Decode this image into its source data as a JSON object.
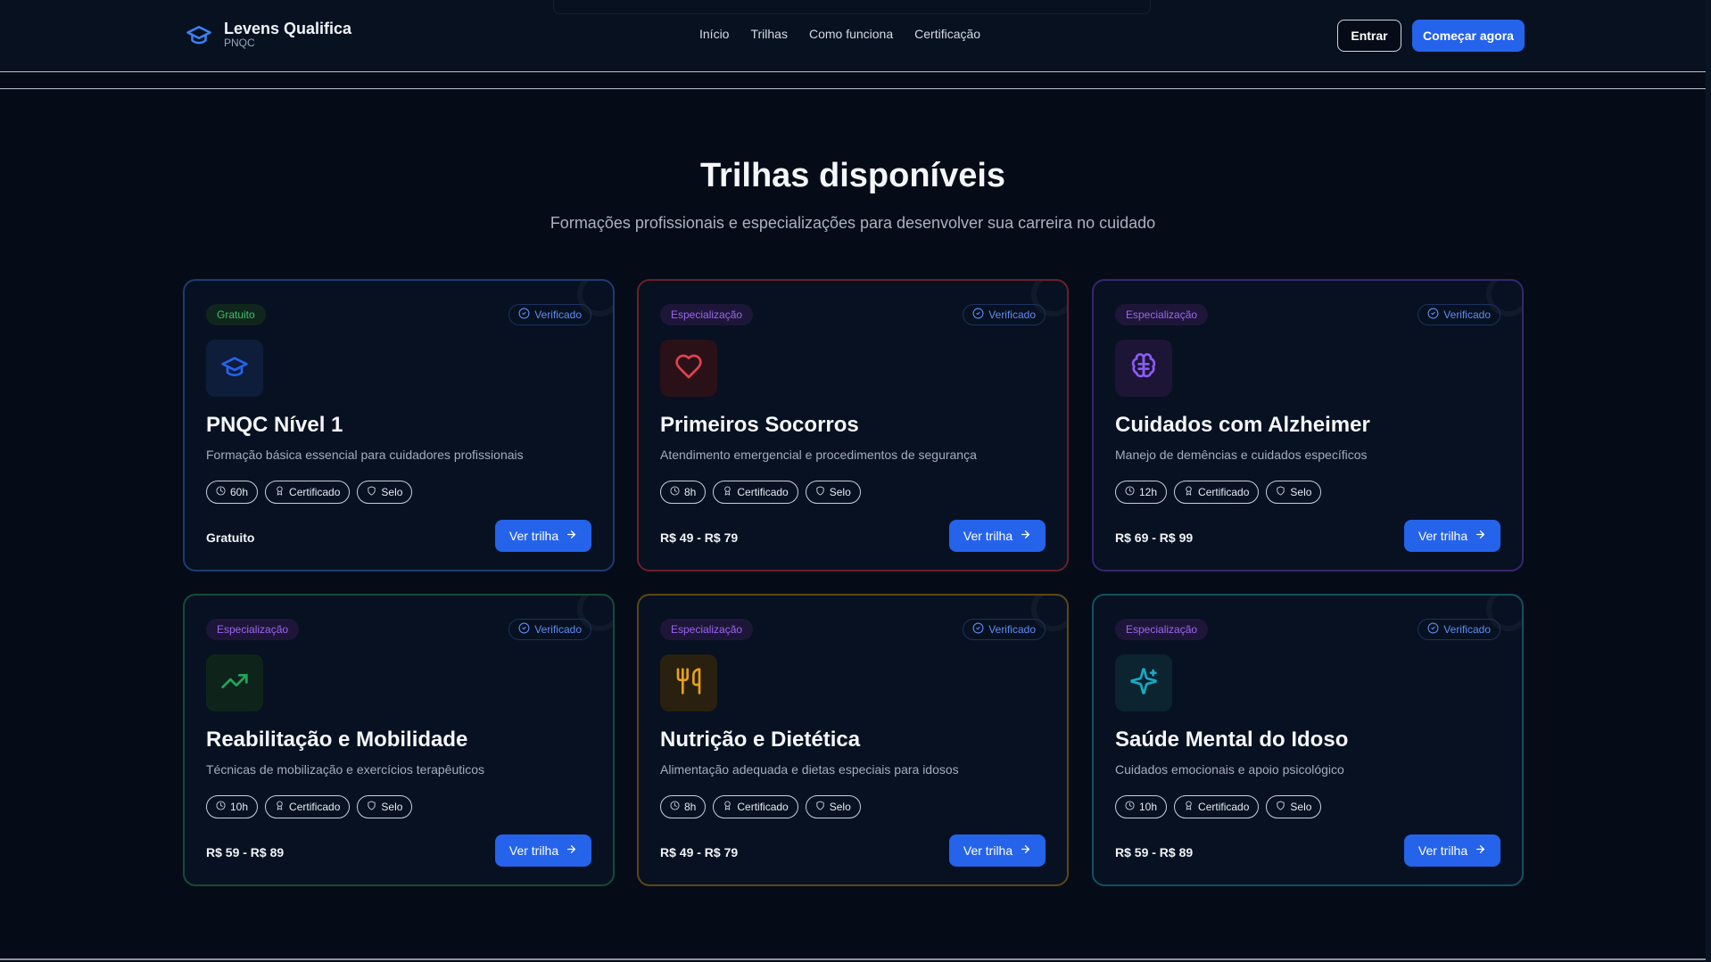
{
  "brand": {
    "name": "Levens Qualifica",
    "sub": "PNQC",
    "icon": "graduation-cap-icon"
  },
  "nav": [
    {
      "label": "Início"
    },
    {
      "label": "Trilhas"
    },
    {
      "label": "Como funciona"
    },
    {
      "label": "Certificação"
    }
  ],
  "header": {
    "login_label": "Entrar",
    "start_label": "Começar agora"
  },
  "section": {
    "title": "Trilhas disponíveis",
    "subtitle": "Formações profissionais e especializações para desenvolver sua carreira no cuidado"
  },
  "common": {
    "verified_label": "Verificado",
    "button_label": "Ver trilha",
    "cert_label": "Certificado",
    "seal_label": "Selo"
  },
  "cards": [
    {
      "tag": "Gratuito",
      "tag_type": "free",
      "icon": "graduation-cap-icon",
      "accent": "#2563eb",
      "title": "PNQC Nível 1",
      "description": "Formação básica essencial para cuidadores profissionais",
      "hours": "60h",
      "price": "Gratuito"
    },
    {
      "tag": "Especialização",
      "tag_type": "spec",
      "icon": "heart-icon",
      "accent": "#e0434f",
      "title": "Primeiros Socorros",
      "description": "Atendimento emergencial e procedimentos de segurança",
      "hours": "8h",
      "price": "R$ 49 - R$ 79"
    },
    {
      "tag": "Especialização",
      "tag_type": "spec",
      "icon": "brain-icon",
      "accent": "#8b5cf6",
      "title": "Cuidados com Alzheimer",
      "description": "Manejo de demências e cuidados específicos",
      "hours": "12h",
      "price": "R$ 69 - R$ 99"
    },
    {
      "tag": "Especialização",
      "tag_type": "spec",
      "icon": "trending-up-icon",
      "accent": "#22a55b",
      "title": "Reabilitação e Mobilidade",
      "description": "Técnicas de mobilização e exercícios terapêuticos",
      "hours": "10h",
      "price": "R$ 59 - R$ 89"
    },
    {
      "tag": "Especialização",
      "tag_type": "spec",
      "icon": "utensils-icon",
      "accent": "#e6a11a",
      "title": "Nutrição e Dietética",
      "description": "Alimentação adequada e dietas especiais para idosos",
      "hours": "8h",
      "price": "R$ 49 - R$ 79"
    },
    {
      "tag": "Especialização",
      "tag_type": "spec",
      "icon": "sparkles-icon",
      "accent": "#19a9c4",
      "title": "Saúde Mental do Idoso",
      "description": "Cuidados emocionais e apoio psicológico",
      "hours": "10h",
      "price": "R$ 59 - R$ 89"
    }
  ]
}
